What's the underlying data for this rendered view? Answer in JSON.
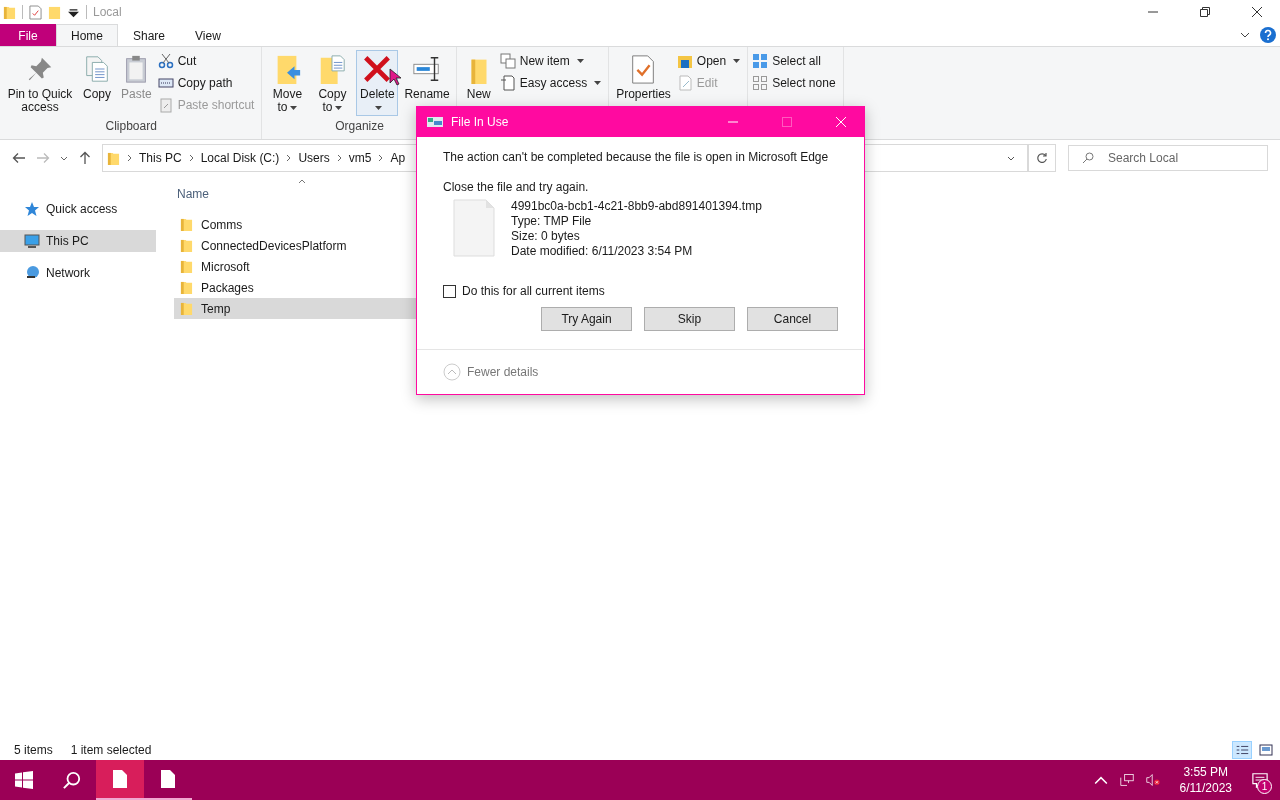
{
  "window": {
    "title": "Local"
  },
  "tabs": [
    {
      "label": "File",
      "kind": "file",
      "selected": false
    },
    {
      "label": "Home",
      "kind": "tab",
      "selected": true
    },
    {
      "label": "Share",
      "kind": "tab",
      "selected": false
    },
    {
      "label": "View",
      "kind": "tab",
      "selected": false
    }
  ],
  "ribbon": [
    {
      "label": "Clipboard",
      "items": [
        {
          "kind": "large",
          "label": "Pin to Quick access",
          "disabled": false,
          "dropdown": false,
          "hovered": false
        },
        {
          "kind": "large",
          "label": "Copy",
          "disabled": false,
          "dropdown": false,
          "hovered": false
        },
        {
          "kind": "large",
          "label": "Paste",
          "disabled": true,
          "dropdown": false,
          "hovered": false
        },
        {
          "kind": "stack",
          "items": [
            {
              "label": "Cut",
              "disabled": false,
              "dropdown": false
            },
            {
              "label": "Copy path",
              "disabled": false,
              "dropdown": false
            },
            {
              "label": "Paste shortcut",
              "disabled": true,
              "dropdown": false
            }
          ]
        }
      ]
    },
    {
      "label": "Organize",
      "items": [
        {
          "kind": "large",
          "label": "Move to",
          "disabled": false,
          "dropdown": true,
          "hovered": false
        },
        {
          "kind": "large",
          "label": "Copy to",
          "disabled": false,
          "dropdown": true,
          "hovered": false
        },
        {
          "kind": "large",
          "label": "Delete",
          "disabled": false,
          "dropdown": true,
          "hovered": true
        },
        {
          "kind": "large",
          "label": "Rename",
          "disabled": false,
          "dropdown": false,
          "hovered": false
        }
      ]
    },
    {
      "items": [
        {
          "kind": "large",
          "label": "New",
          "disabled": false,
          "dropdown": false,
          "hovered": false
        },
        {
          "kind": "stack",
          "items": [
            {
              "label": "New item",
              "disabled": false,
              "dropdown": true
            },
            {
              "label": "Easy access",
              "disabled": false,
              "dropdown": true
            }
          ]
        }
      ]
    },
    {
      "items": [
        {
          "kind": "large",
          "label": "Properties",
          "disabled": false,
          "dropdown": false,
          "hovered": false
        },
        {
          "kind": "stack",
          "items": [
            {
              "label": "Open",
              "disabled": false,
              "dropdown": true
            },
            {
              "label": "Edit",
              "disabled": true,
              "dropdown": false
            }
          ]
        }
      ]
    },
    {
      "items": [
        {
          "kind": "stack",
          "items": [
            {
              "label": "Select all",
              "disabled": false,
              "dropdown": false
            },
            {
              "label": "Select none",
              "disabled": false,
              "dropdown": false
            }
          ]
        }
      ]
    }
  ],
  "address": {
    "crumbs": [
      "This PC",
      "Local Disk (C:)",
      "Users",
      "vm5",
      "Ap"
    ]
  },
  "search": {
    "placeholder": "Search Local"
  },
  "nav": [
    {
      "label": "Quick access",
      "selected": false
    },
    {
      "label": "This PC",
      "selected": true
    },
    {
      "label": "Network",
      "selected": false
    }
  ],
  "list": {
    "column": "Name",
    "rows": [
      {
        "name": "Comms",
        "selected": false
      },
      {
        "name": "ConnectedDevicesPlatform",
        "selected": false
      },
      {
        "name": "Microsoft",
        "selected": false
      },
      {
        "name": "Packages",
        "selected": false
      },
      {
        "name": "Temp",
        "selected": true
      }
    ]
  },
  "status_bar": {
    "count": "5 items",
    "selection": "1 item selected"
  },
  "dialog": {
    "title": "File In Use",
    "message": "The action can't be completed because the file is open in Microsoft Edge",
    "hint": "Close the file and try again.",
    "file": {
      "name": "4991bc0a-bcb1-4c21-8bb9-abd891401394.tmp",
      "type": "Type: TMP File",
      "size": "Size: 0 bytes",
      "modified": "Date modified: 6/11/2023 3:54 PM"
    },
    "checkbox": {
      "label": "Do this for all current items",
      "checked": false
    },
    "buttons": [
      "Try Again",
      "Skip",
      "Cancel"
    ],
    "details_toggle": "Fewer details"
  },
  "taskbar": {
    "apps": [
      {
        "selected": true
      },
      {
        "selected": false
      }
    ],
    "time": "3:55 PM",
    "date": "6/11/2023",
    "notifications": "1"
  }
}
